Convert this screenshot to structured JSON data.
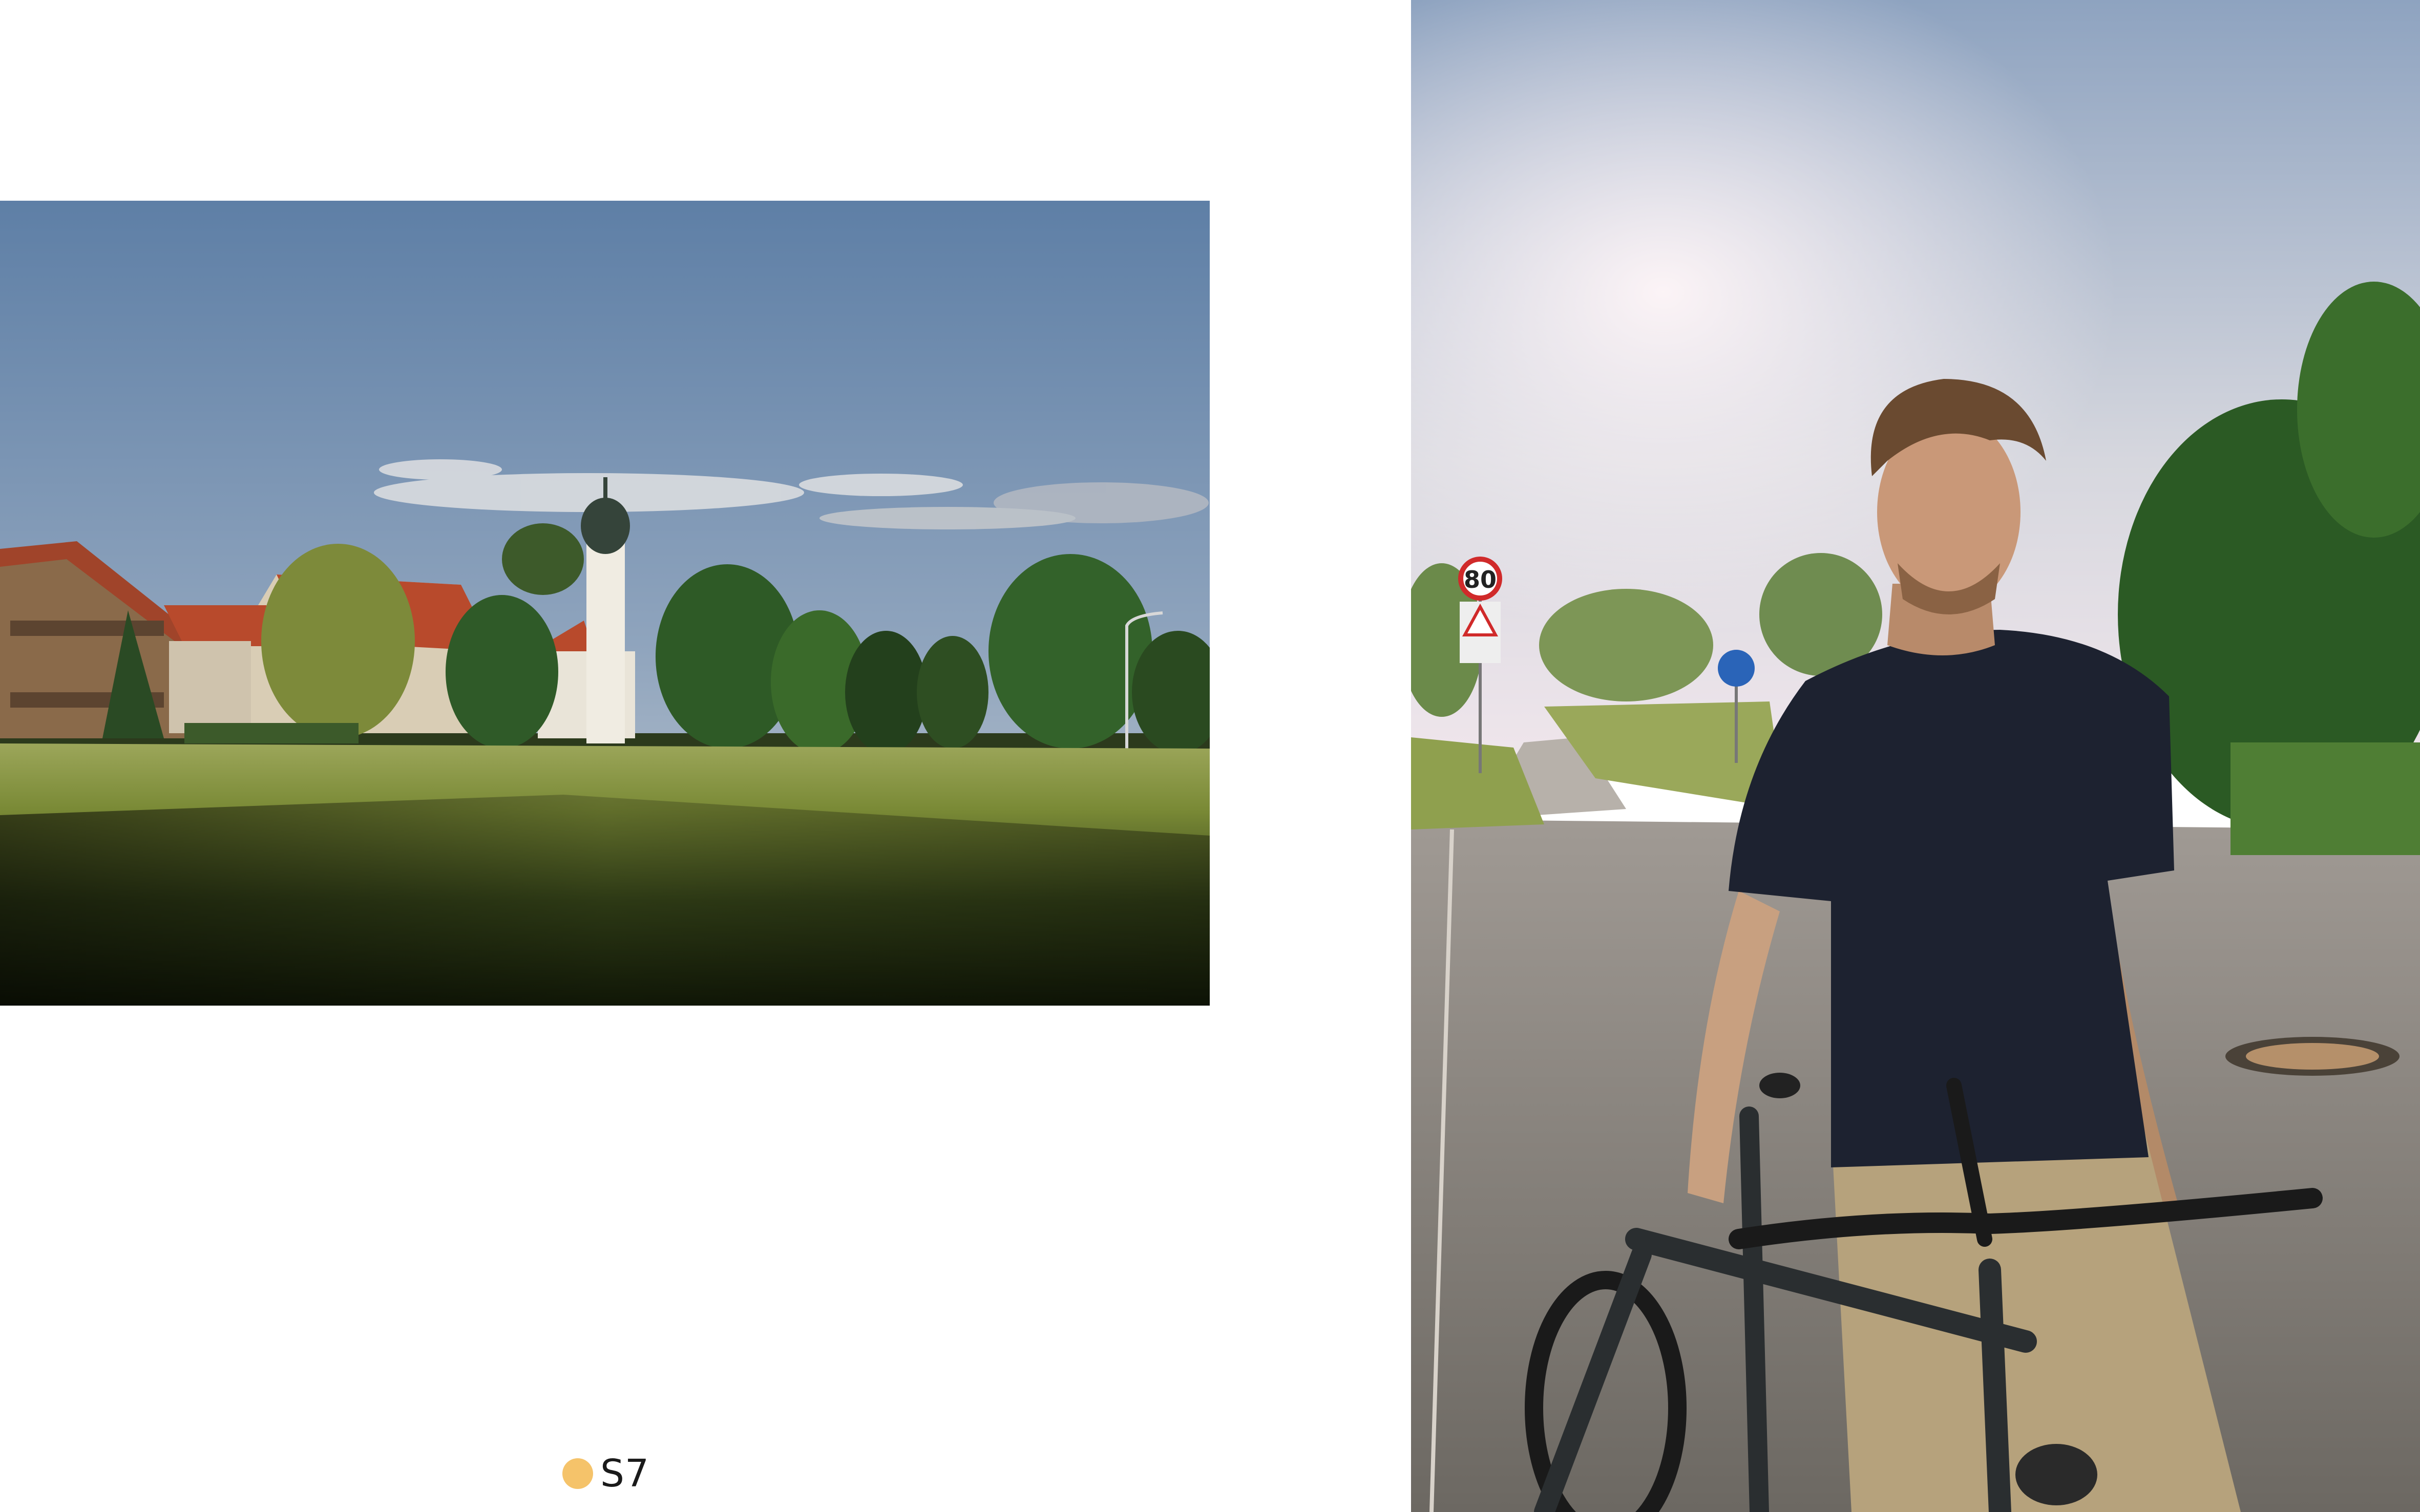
{
  "page": {
    "marker": {
      "number": "S7",
      "dot_color": "#f5c36a"
    }
  },
  "photos": [
    {
      "subject": "meadow-with-village-and-onion-dome-church",
      "signs": []
    },
    {
      "subject": "man-with-bicycle-on-country-road",
      "signs": [
        {
          "text": "80"
        }
      ]
    }
  ]
}
